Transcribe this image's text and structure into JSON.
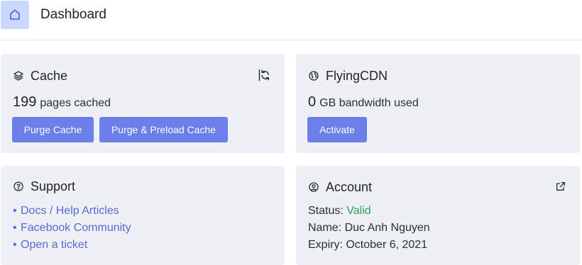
{
  "header": {
    "title": "Dashboard",
    "home_icon": "home-icon"
  },
  "cache": {
    "title": "Cache",
    "icon": "layers-icon",
    "refresh_icon": "refresh-icon",
    "count": "199",
    "count_label": "pages cached",
    "buttons": {
      "purge": "Purge Cache",
      "purge_preload": "Purge & Preload Cache"
    }
  },
  "cdn": {
    "title": "FlyingCDN",
    "icon": "globe-icon",
    "bandwidth": "0",
    "bandwidth_label": "GB bandwidth used",
    "activate": "Activate"
  },
  "support": {
    "title": "Support",
    "icon": "help-circle-icon",
    "links": [
      "Docs / Help Articles",
      "Facebook Community",
      "Open a ticket"
    ]
  },
  "account": {
    "title": "Account",
    "icon": "user-circle-icon",
    "external_icon": "external-link-icon",
    "status_label": "Status:",
    "status_value": "Valid",
    "name_label": "Name:",
    "name_value": "Duc Anh Nguyen",
    "expiry_label": "Expiry:",
    "expiry_value": "October 6, 2021"
  },
  "colors": {
    "accent": "#6b7ee9",
    "link": "#5b67d6",
    "valid": "#2f9e55",
    "card_bg": "#edf1f6",
    "home_bg": "#c9d8fb"
  }
}
